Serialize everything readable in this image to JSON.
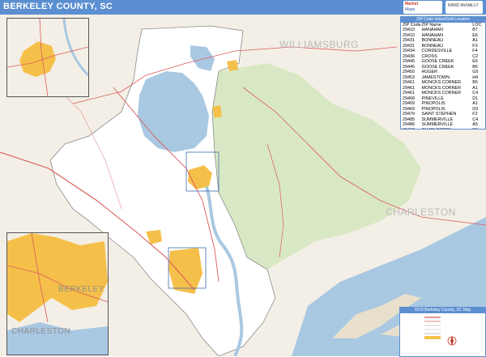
{
  "header": {
    "title": "BERKELEY COUNTY, SC"
  },
  "logo": {
    "line1": "Market",
    "line2": "Maps",
    "badge": "RAND McNALLY"
  },
  "map_labels": {
    "williamsburg": "WILLIAMSBURG",
    "charleston_county": "CHARLESTON",
    "berkeley_inset": "BERKELEY",
    "charleston_inset": "CHARLESTON"
  },
  "zip_table": {
    "title": "ZIP Code Index/Grid Location",
    "headers": [
      "ZIP Code",
      "ZIP Name",
      "LOC"
    ],
    "rows": [
      [
        "29410",
        "HANAHAN",
        "B7"
      ],
      [
        "29410",
        "HANAHAN",
        "E6"
      ],
      [
        "29431",
        "BONNEAU",
        "A1"
      ],
      [
        "29431",
        "BONNEAU",
        "F3"
      ],
      [
        "29434",
        "CORDESVILLE",
        "F4"
      ],
      [
        "29436",
        "CROSS",
        "C2"
      ],
      [
        "29445",
        "GOOSE CREEK",
        "E6"
      ],
      [
        "29445",
        "GOOSE CREEK",
        "B6"
      ],
      [
        "29450",
        "HUGER",
        "G5"
      ],
      [
        "29453",
        "JAMESTOWN",
        "H4"
      ],
      [
        "29461",
        "MONCKS CORNER",
        "B5"
      ],
      [
        "29461",
        "MONCKS CORNER",
        "A1"
      ],
      [
        "29461",
        "MONCKS CORNER",
        "C4"
      ],
      [
        "29468",
        "PINEVILLE",
        "D1"
      ],
      [
        "29469",
        "PINOPOLIS",
        "A1"
      ],
      [
        "29469",
        "PINOPOLIS",
        "D3"
      ],
      [
        "29479",
        "SAINT STEPHEN",
        "F2"
      ],
      [
        "29485",
        "SUMMERVILLE",
        "C4"
      ],
      [
        "29486",
        "SUMMERVILLE",
        "A5"
      ],
      [
        "29492",
        "CHARLESTON",
        "F7"
      ]
    ]
  },
  "legend": {
    "title": "2018 Berkeley County, SC Map",
    "items": [
      "Interstate",
      "State",
      "Primary Streets",
      "Secondary Streets",
      "Railroad",
      "Urban Areas",
      "State Highway",
      "US Highway",
      "Interstate Highway",
      "Toll Roads"
    ]
  },
  "colors": {
    "header": "#5b8fd1",
    "water": "#a9c8e2",
    "county_fill": "#ffffff",
    "surrounding": "#f4efe6",
    "forest": "#d9e8c4",
    "zip_area": "#f5c04a",
    "roads": "#d95b5b"
  }
}
